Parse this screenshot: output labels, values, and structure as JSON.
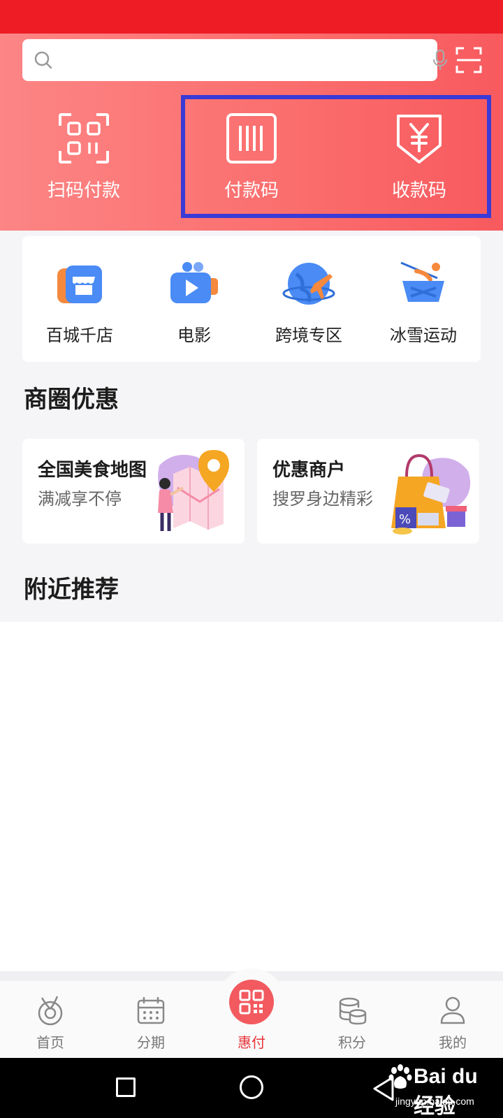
{
  "search": {
    "placeholder": "",
    "value": ""
  },
  "quick_actions": [
    {
      "label": "扫码付款",
      "icon": "scan-pay-icon"
    },
    {
      "label": "付款码",
      "icon": "barcode-icon"
    },
    {
      "label": "收款码",
      "icon": "yuan-receive-icon"
    }
  ],
  "categories": [
    {
      "label": "百城千店",
      "icon": "store-icon"
    },
    {
      "label": "电影",
      "icon": "movie-camera-icon"
    },
    {
      "label": "跨境专区",
      "icon": "globe-plane-icon"
    },
    {
      "label": "冰雪运动",
      "icon": "ski-icon"
    }
  ],
  "sections": {
    "deals_title": "商圈优惠",
    "nearby_title": "附近推荐"
  },
  "promos": [
    {
      "title": "全国美食地图",
      "subtitle": "满减享不停"
    },
    {
      "title": "优惠商户",
      "subtitle": "搜罗身边精彩"
    }
  ],
  "tabs": [
    {
      "label": "首页",
      "icon": "home-icon",
      "active": false
    },
    {
      "label": "分期",
      "icon": "calendar-icon",
      "active": false
    },
    {
      "label": "惠付",
      "icon": "qr-code-icon",
      "active": true
    },
    {
      "label": "积分",
      "icon": "coins-icon",
      "active": false
    },
    {
      "label": "我的",
      "icon": "user-icon",
      "active": false
    }
  ],
  "colors": {
    "brand_red": "#ee1c25",
    "hero_start": "#fc8585",
    "hero_end": "#f85a5e",
    "highlight_box": "#3a3ad6",
    "active_tab": "#e8333a"
  },
  "watermark": {
    "brand": "Bai du 经验",
    "url": "jingyan.baidu.com"
  }
}
